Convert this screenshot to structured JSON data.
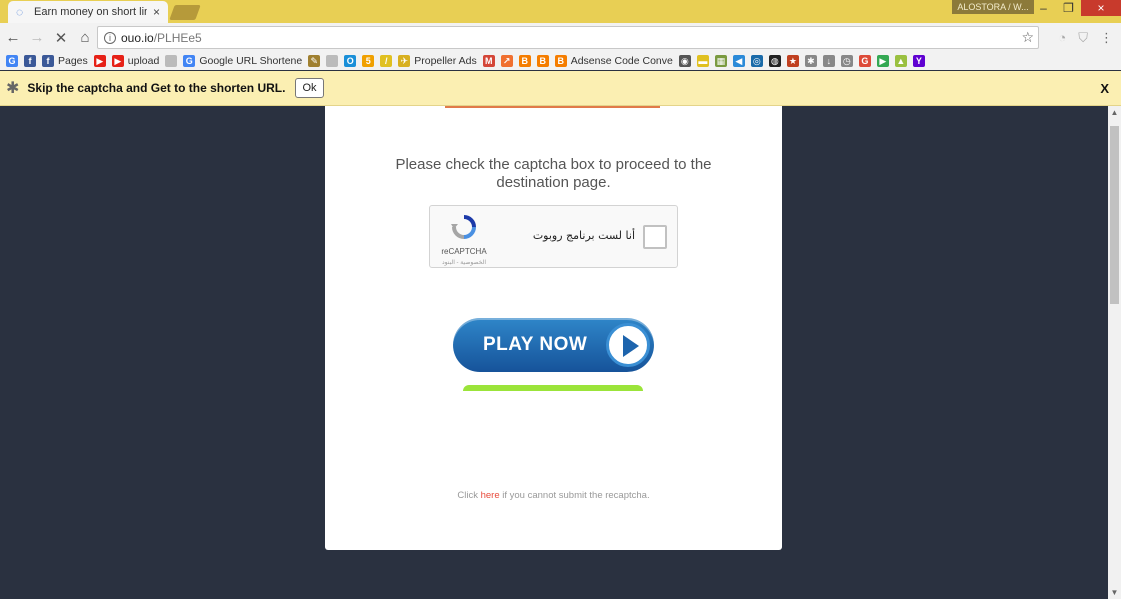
{
  "window": {
    "tab_title": "Earn money on short link",
    "tab_close": "×",
    "profile": "ALOSTORA / W...",
    "minimize": "–",
    "restore": "❐",
    "close": "×"
  },
  "toolbar": {
    "back": "←",
    "forward": "→",
    "stop": "✕",
    "home": "⌂",
    "url_host": "ouo.io",
    "url_path": "/PLHEe5",
    "bookmark_star": "☆"
  },
  "bookmarks": [
    {
      "label": "",
      "icon": "google-icon",
      "color": "#4285f4",
      "glyph": "G"
    },
    {
      "label": "",
      "icon": "facebook-icon",
      "color": "#3b5998",
      "glyph": "f"
    },
    {
      "label": "Pages",
      "icon": "facebook-icon",
      "color": "#3b5998",
      "glyph": "f"
    },
    {
      "label": "",
      "icon": "youtube-icon",
      "color": "#e62117",
      "glyph": "▶"
    },
    {
      "label": "upload",
      "icon": "youtube-icon",
      "color": "#e62117",
      "glyph": "▶"
    },
    {
      "label": "",
      "icon": "page-icon",
      "color": "#bbbbbb",
      "glyph": ""
    },
    {
      "label": "Google URL Shortene",
      "icon": "google-icon",
      "color": "#4285f4",
      "glyph": "G"
    },
    {
      "label": "",
      "icon": "pen-icon",
      "color": "#a08030",
      "glyph": "✎"
    },
    {
      "label": "",
      "icon": "page-icon",
      "color": "#bbbbbb",
      "glyph": ""
    },
    {
      "label": "",
      "icon": "o-icon",
      "color": "#1a8fd8",
      "glyph": "O"
    },
    {
      "label": "",
      "icon": "five-icon",
      "color": "#f0a000",
      "glyph": "5"
    },
    {
      "label": "",
      "icon": "pencil-icon",
      "color": "#e0c020",
      "glyph": "/"
    },
    {
      "label": "Propeller Ads",
      "icon": "propeller-icon",
      "color": "#d8b020",
      "glyph": "✈"
    },
    {
      "label": "",
      "icon": "gmail-icon",
      "color": "#d44638",
      "glyph": "M"
    },
    {
      "label": "",
      "icon": "arrow-icon",
      "color": "#f07030",
      "glyph": "↗"
    },
    {
      "label": "",
      "icon": "blogger-icon",
      "color": "#f57d00",
      "glyph": "B"
    },
    {
      "label": "",
      "icon": "blogger-icon",
      "color": "#f57d00",
      "glyph": "B"
    },
    {
      "label": "Adsense Code Conve",
      "icon": "blogger-icon",
      "color": "#f57d00",
      "glyph": "B"
    },
    {
      "label": "",
      "icon": "ext-icon",
      "color": "#555555",
      "glyph": "◉"
    },
    {
      "label": "",
      "icon": "ext-icon",
      "color": "#e0c020",
      "glyph": "▬"
    },
    {
      "label": "",
      "icon": "ext-icon",
      "color": "#7a9a40",
      "glyph": "▦"
    },
    {
      "label": "",
      "icon": "ext-icon",
      "color": "#2b8ad8",
      "glyph": "◀"
    },
    {
      "label": "",
      "icon": "ext-icon",
      "color": "#1a6aa8",
      "glyph": "◎"
    },
    {
      "label": "",
      "icon": "ext-icon",
      "color": "#222222",
      "glyph": "◍"
    },
    {
      "label": "",
      "icon": "ext-icon",
      "color": "#c04020",
      "glyph": "★"
    },
    {
      "label": "",
      "icon": "ext-icon",
      "color": "#888888",
      "glyph": "✱"
    },
    {
      "label": "",
      "icon": "download-icon",
      "color": "#888888",
      "glyph": "↓"
    },
    {
      "label": "",
      "icon": "history-icon",
      "color": "#888888",
      "glyph": "◷"
    },
    {
      "label": "",
      "icon": "gplus-icon",
      "color": "#dd4b39",
      "glyph": "G"
    },
    {
      "label": "",
      "icon": "play-store-icon",
      "color": "#34a853",
      "glyph": "▶"
    },
    {
      "label": "",
      "icon": "ext-icon",
      "color": "#9ac040",
      "glyph": "▲"
    },
    {
      "label": "",
      "icon": "yahoo-icon",
      "color": "#5f01d1",
      "glyph": "Y"
    }
  ],
  "infobar": {
    "message": "Skip the captcha and Get to the shorten URL.",
    "ok_label": "Ok",
    "close_label": "X"
  },
  "page": {
    "heading": "Please check the captcha box to proceed to the destination page.",
    "recaptcha_label": "أنا لست برنامج روبوت",
    "recaptcha_brand": "reCAPTCHA",
    "recaptcha_terms": "الخصوصية - البنود",
    "play_label": "PLAY NOW",
    "footnote_before": "Click ",
    "footnote_link": "here",
    "footnote_after": " if you cannot submit the recaptcha."
  }
}
